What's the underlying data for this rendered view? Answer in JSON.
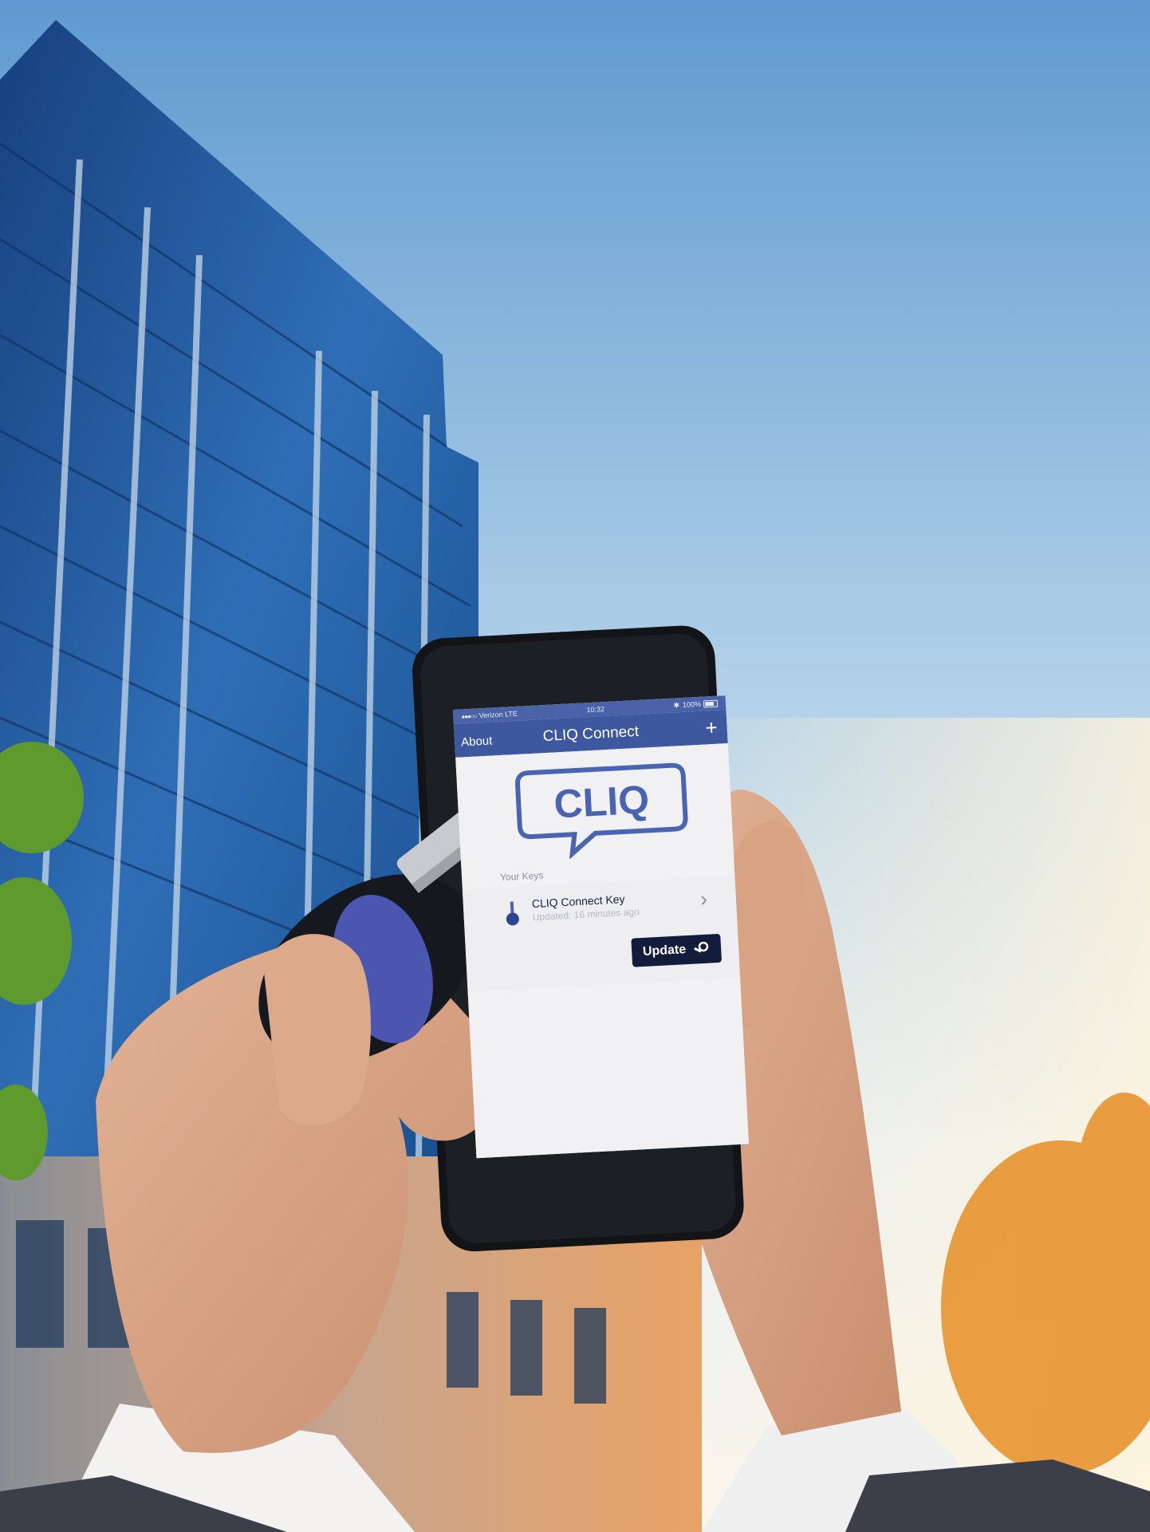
{
  "phone": {
    "status": {
      "carrier": "Verizon LTE",
      "time": "10:32",
      "battery": "100%"
    },
    "navbar": {
      "left_label": "About",
      "title": "CLIQ Connect",
      "add_icon": "plus-icon"
    },
    "logo_text": "CLIQ",
    "keys_section_label": "Your Keys",
    "key_item": {
      "name": "CLIQ Connect Key",
      "status": "Updated: 16 minutes ago",
      "icon": "key-fob-icon",
      "chevron": "chevron-right-icon"
    },
    "update_button_label": "Update"
  }
}
